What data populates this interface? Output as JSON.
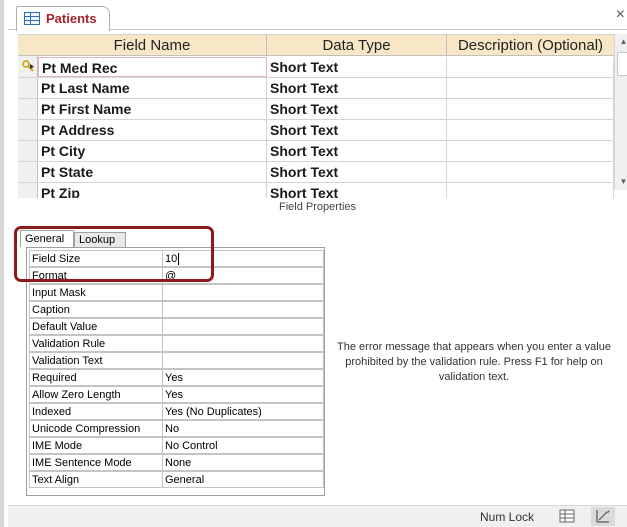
{
  "tab": {
    "title": "Patients",
    "close_glyph": "×"
  },
  "grid": {
    "headers": [
      "Field Name",
      "Data Type",
      "Description (Optional)"
    ],
    "rows": [
      {
        "name": "Pt Med Rec",
        "type": "Short Text",
        "desc": ""
      },
      {
        "name": "Pt Last Name",
        "type": "Short Text",
        "desc": ""
      },
      {
        "name": "Pt First Name",
        "type": "Short Text",
        "desc": ""
      },
      {
        "name": "Pt Address",
        "type": "Short Text",
        "desc": ""
      },
      {
        "name": "Pt City",
        "type": "Short Text",
        "desc": ""
      },
      {
        "name": "Pt State",
        "type": "Short Text",
        "desc": ""
      },
      {
        "name": "Pt Zip",
        "type": "Short Text",
        "desc": ""
      }
    ]
  },
  "properties": {
    "section_label": "Field Properties",
    "tabs": {
      "general": "General",
      "lookup": "Lookup"
    },
    "rows": [
      {
        "label": "Field Size",
        "value": "10"
      },
      {
        "label": "Format",
        "value": "@"
      },
      {
        "label": "Input Mask",
        "value": ""
      },
      {
        "label": "Caption",
        "value": ""
      },
      {
        "label": "Default Value",
        "value": ""
      },
      {
        "label": "Validation Rule",
        "value": ""
      },
      {
        "label": "Validation Text",
        "value": ""
      },
      {
        "label": "Required",
        "value": "Yes"
      },
      {
        "label": "Allow Zero Length",
        "value": "Yes"
      },
      {
        "label": "Indexed",
        "value": "Yes (No Duplicates)"
      },
      {
        "label": "Unicode Compression",
        "value": "No"
      },
      {
        "label": "IME Mode",
        "value": "No Control"
      },
      {
        "label": "IME Sentence Mode",
        "value": "None"
      },
      {
        "label": "Text Align",
        "value": "General"
      }
    ],
    "help_text": "The error message that appears when you enter a value prohibited by the validation rule. Press F1 for help on validation text."
  },
  "status": {
    "num_lock": "Num Lock"
  },
  "icons": {
    "table": "table-icon",
    "key": "primary-key-icon",
    "datasheet_view": "datasheet-view-icon",
    "design_view": "design-view-icon"
  },
  "colors": {
    "tab_title": "#a8232c",
    "header_bg": "#f7e7c7",
    "highlight": "#8b1a1a"
  }
}
